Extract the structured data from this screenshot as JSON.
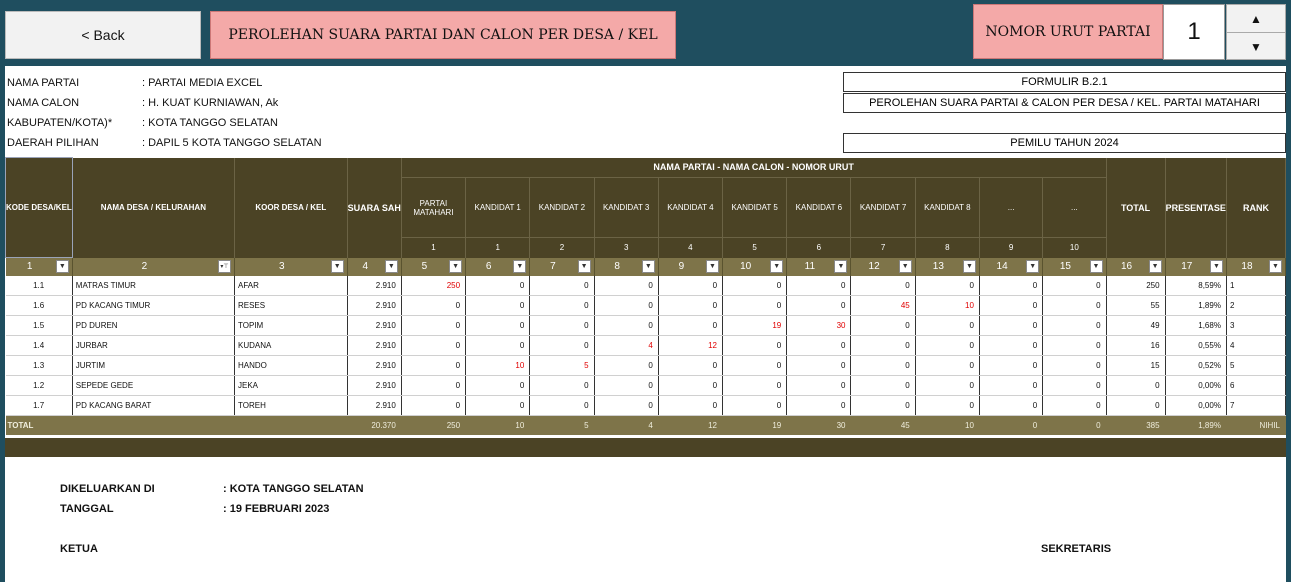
{
  "toolbar": {
    "back_label": "< Back",
    "title": "PEROLEHAN SUARA PARTAI DAN CALON PER DESA / KEL",
    "nomor_label": "NOMOR URUT PARTAI",
    "nomor_value": "1",
    "spin_up": "▲",
    "spin_down": "▼"
  },
  "info": {
    "nama_partai_label": "NAMA PARTAI",
    "nama_partai": ": PARTAI MEDIA EXCEL",
    "nama_calon_label": "NAMA CALON",
    "nama_calon": ": H. KUAT KURNIAWAN, Ak",
    "kabupaten_label": "KABUPATEN/KOTA)*",
    "kabupaten": ": KOTA TANGGO SELATAN",
    "daerah_label": "DAERAH PILIHAN",
    "daerah": ": DAPIL 5 KOTA TANGGO SELATAN"
  },
  "form": {
    "code": "FORMULIR B.2.1",
    "desc": "PEROLEHAN SUARA PARTAI & CALON PER DESA / KEL. PARTAI MATAHARI",
    "election": "PEMILU TAHUN 2024"
  },
  "table": {
    "group_header": "NAMA PARTAI - NAMA CALON - NOMOR URUT",
    "kode_header": "KODE DESA/KEL",
    "desa_header": "NAMA DESA / KELURAHAN",
    "koor_header": "KOOR DESA / KEL",
    "suara_header": "SUARA SAH",
    "total_header": "TOTAL",
    "presentase_header": "PRESENTASE",
    "rank_header": "RANK",
    "candidate_headers": [
      "PARTAI MATAHARI",
      "KANDIDAT 1",
      "KANDIDAT 2",
      "KANDIDAT 3",
      "KANDIDAT 4",
      "KANDIDAT 5",
      "KANDIDAT 6",
      "KANDIDAT 7",
      "KANDIDAT 8",
      "...",
      "..."
    ],
    "candidate_numbers": [
      "1",
      "1",
      "2",
      "3",
      "4",
      "5",
      "6",
      "7",
      "8",
      "9",
      "10"
    ],
    "filter_numbers": [
      "1",
      "2",
      "3",
      "4",
      "5",
      "6",
      "7",
      "8",
      "9",
      "10",
      "11",
      "12",
      "13",
      "14",
      "15",
      "16",
      "17",
      "18"
    ],
    "rows": [
      {
        "kode": "1.1",
        "desa": "MATRAS TIMUR",
        "koor": "AFAR",
        "suara": "2.910",
        "votes": [
          "250",
          "0",
          "0",
          "0",
          "0",
          "0",
          "0",
          "0",
          "0",
          "0",
          "0"
        ],
        "total": "250",
        "pct": "8,59%",
        "rank": "1"
      },
      {
        "kode": "1.6",
        "desa": "PD KACANG TIMUR",
        "koor": "RESES",
        "suara": "2.910",
        "votes": [
          "0",
          "0",
          "0",
          "0",
          "0",
          "0",
          "0",
          "45",
          "10",
          "0",
          "0"
        ],
        "total": "55",
        "pct": "1,89%",
        "rank": "2"
      },
      {
        "kode": "1.5",
        "desa": "PD DUREN",
        "koor": "TOPIM",
        "suara": "2.910",
        "votes": [
          "0",
          "0",
          "0",
          "0",
          "0",
          "19",
          "30",
          "0",
          "0",
          "0",
          "0"
        ],
        "total": "49",
        "pct": "1,68%",
        "rank": "3"
      },
      {
        "kode": "1.4",
        "desa": "JURBAR",
        "koor": "KUDANA",
        "suara": "2.910",
        "votes": [
          "0",
          "0",
          "0",
          "4",
          "12",
          "0",
          "0",
          "0",
          "0",
          "0",
          "0"
        ],
        "total": "16",
        "pct": "0,55%",
        "rank": "4"
      },
      {
        "kode": "1.3",
        "desa": "JURTIM",
        "koor": "HANDO",
        "suara": "2.910",
        "votes": [
          "0",
          "10",
          "5",
          "0",
          "0",
          "0",
          "0",
          "0",
          "0",
          "0",
          "0"
        ],
        "total": "15",
        "pct": "0,52%",
        "rank": "5"
      },
      {
        "kode": "1.2",
        "desa": "SEPEDE GEDE",
        "koor": "JEKA",
        "suara": "2.910",
        "votes": [
          "0",
          "0",
          "0",
          "0",
          "0",
          "0",
          "0",
          "0",
          "0",
          "0",
          "0"
        ],
        "total": "0",
        "pct": "0,00%",
        "rank": "6"
      },
      {
        "kode": "1.7",
        "desa": "PD KACANG BARAT",
        "koor": "TOREH",
        "suara": "2.910",
        "votes": [
          "0",
          "0",
          "0",
          "0",
          "0",
          "0",
          "0",
          "0",
          "0",
          "0",
          "0"
        ],
        "total": "0",
        "pct": "0,00%",
        "rank": "7"
      }
    ],
    "totals": {
      "label": "TOTAL",
      "suara": "20.370",
      "votes": [
        "250",
        "10",
        "5",
        "4",
        "12",
        "19",
        "30",
        "45",
        "10",
        "0",
        "0"
      ],
      "total": "385",
      "pct": "1,89%",
      "rank": "NIHIL"
    }
  },
  "footer": {
    "dikeluarkan_label": "DIKELUARKAN DI",
    "dikeluarkan": ": KOTA TANGGO SELATAN",
    "tanggal_label": "TANGGAL",
    "tanggal": ": 19 FEBRUARI 2023",
    "ketua": "KETUA",
    "sekretaris": "SEKRETARIS"
  },
  "colors": {
    "header_dark": "#4b4325",
    "header_mid": "#7e7449",
    "accent_pink": "#f4a9a8",
    "background": "#1f4e5f",
    "highlight_red": "#e00000"
  }
}
